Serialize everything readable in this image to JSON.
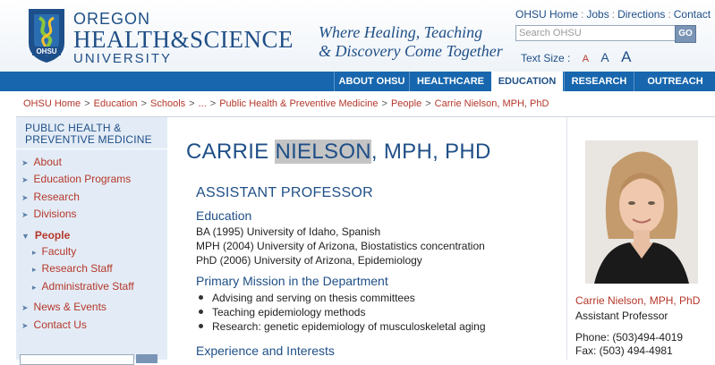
{
  "header": {
    "logo": {
      "line1": "OREGON",
      "line2": "HEALTH&SCIENCE",
      "line3": "UNIVERSITY",
      "badge": "OHSU"
    },
    "tagline": {
      "line1": "Where Healing, Teaching",
      "line2": "& Discovery Come Together"
    },
    "top_links": [
      "OHSU Home",
      "Jobs",
      "Directions",
      "Contact"
    ],
    "search": {
      "placeholder": "Search OHSU",
      "go_label": "GO"
    },
    "text_size": {
      "label": "Text Size :",
      "small": "A",
      "medium": "A",
      "large": "A"
    }
  },
  "nav": {
    "tabs": [
      {
        "label": "ABOUT OHSU"
      },
      {
        "label": "HEALTHCARE"
      },
      {
        "label": "EDUCATION",
        "active": true
      },
      {
        "label": "RESEARCH"
      },
      {
        "label": "OUTREACH"
      }
    ]
  },
  "breadcrumb": [
    "OHSU Home",
    "Education",
    "Schools",
    "...",
    "Public Health & Preventive Medicine",
    "People",
    "Carrie Nielson, MPH, PhD"
  ],
  "sidebar": {
    "title_line1": "PUBLIC HEALTH &",
    "title_line2": "PREVENTIVE MEDICINE",
    "items": [
      {
        "label": "About"
      },
      {
        "label": "Education Programs"
      },
      {
        "label": "Research"
      },
      {
        "label": "Divisions"
      },
      {
        "label": "People",
        "active": true
      },
      {
        "label": "Faculty"
      },
      {
        "label": "Research Staff"
      },
      {
        "label": "Administrative Staff"
      },
      {
        "label": "News & Events"
      },
      {
        "label": "Contact Us"
      }
    ]
  },
  "profile": {
    "name_first": "CARRIE",
    "name_last": "NIELSON",
    "name_suffix": ", MPH, PHD",
    "title": "ASSISTANT PROFESSOR",
    "education_heading": "Education",
    "education": [
      "BA (1995) University of Idaho, Spanish",
      "MPH (2004) University of Arizona, Biostatistics concentration",
      "PhD (2006) University of Arizona, Epidemiology"
    ],
    "mission_heading": "Primary Mission in the Department",
    "mission": [
      "Advising and serving on thesis committees",
      "Teaching epidemiology methods",
      "Research: genetic epidemiology of musculoskeletal aging"
    ],
    "interests_heading": "Experience and Interests"
  },
  "contact_card": {
    "name": "Carrie Nielson, MPH, PhD",
    "role": "Assistant Professor",
    "phone": "Phone: (503)494-4019",
    "fax": "Fax: (503) 494-4981"
  },
  "colors": {
    "brand_blue": "#1f4f87",
    "nav_blue": "#1766ae",
    "link_red": "#b5372a",
    "sidebar_bg": "#e3ecf6"
  }
}
